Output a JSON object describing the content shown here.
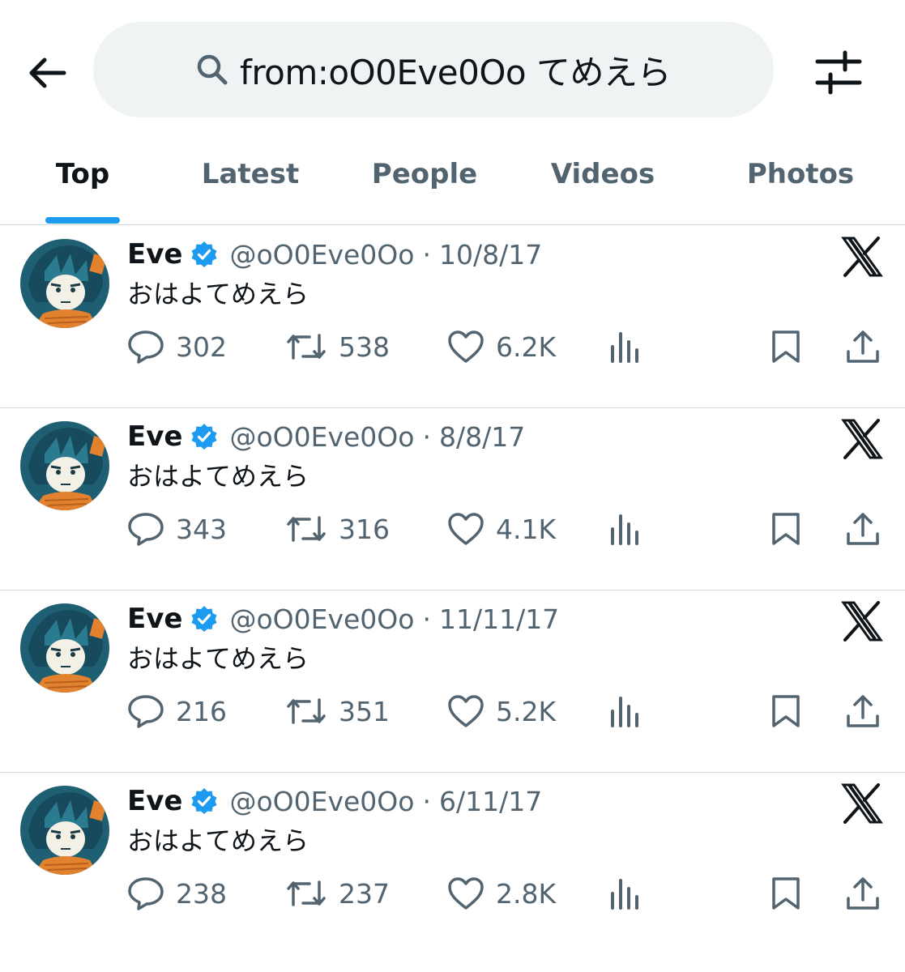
{
  "search": {
    "query": "from:oO0Eve0Oo てめえら"
  },
  "tabs": [
    {
      "label": "Top",
      "active": true
    },
    {
      "label": "Latest",
      "active": false
    },
    {
      "label": "People",
      "active": false
    },
    {
      "label": "Videos",
      "active": false
    },
    {
      "label": "Photos",
      "active": false
    }
  ],
  "colors": {
    "accent": "#1d9bf0",
    "muted": "#536471",
    "text": "#0f1419",
    "search_bg": "#eff3f4"
  },
  "icons": {
    "back": "arrow-left-icon",
    "search": "search-icon",
    "filter": "sliders-icon",
    "verified": "verified-badge-icon",
    "x": "x-logo-icon",
    "reply": "reply-icon",
    "repost": "repost-icon",
    "like": "heart-icon",
    "views": "views-icon",
    "bookmark": "bookmark-icon",
    "share": "share-icon"
  },
  "posts": [
    {
      "name": "Eve",
      "handle": "@oO0Eve0Oo",
      "dot": "·",
      "date": "10/8/17",
      "text": "おはよてめえら",
      "replies": "302",
      "reposts": "538",
      "likes": "6.2K"
    },
    {
      "name": "Eve",
      "handle": "@oO0Eve0Oo",
      "dot": "·",
      "date": "8/8/17",
      "text": "おはよてめえら",
      "replies": "343",
      "reposts": "316",
      "likes": "4.1K"
    },
    {
      "name": "Eve",
      "handle": "@oO0Eve0Oo",
      "dot": "·",
      "date": "11/11/17",
      "text": "おはよてめえら",
      "replies": "216",
      "reposts": "351",
      "likes": "5.2K"
    },
    {
      "name": "Eve",
      "handle": "@oO0Eve0Oo",
      "dot": "·",
      "date": "6/11/17",
      "text": "おはよてめえら",
      "replies": "238",
      "reposts": "237",
      "likes": "2.8K"
    }
  ]
}
